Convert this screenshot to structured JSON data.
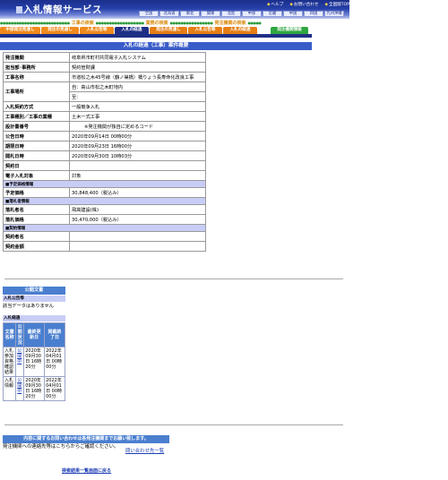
{
  "header": {
    "title": "入札情報サービス",
    "top_links": [
      "ヘルプ",
      "お問い合わせ",
      "全国版TOP"
    ],
    "regions": [
      "全国",
      "北海道",
      "東北",
      "関東",
      "北陸",
      "中部",
      "近畿",
      "中国",
      "四国",
      "九州沖縄"
    ]
  },
  "search_types": [
    "工事の検索",
    "業務の検索",
    "発注機関の検索"
  ],
  "tabs": [
    {
      "label": "中部発注見通し",
      "color": "#f08a1c"
    },
    {
      "label": "発注の見通し",
      "color": "#f08a1c"
    },
    {
      "label": "入札公告等",
      "color": "#f08a1c"
    },
    {
      "label": "入札の経過",
      "color": "#1f2f86"
    },
    {
      "label": "発注の見通し",
      "color": "#e67e14"
    },
    {
      "label": "入札公告等",
      "color": "#e67e14"
    },
    {
      "label": "入札の経過",
      "color": "#e67e14"
    },
    {
      "label": "発注機関情報",
      "color": "#2fa640"
    }
  ],
  "page_title": "入札の経過（工事）案件概要",
  "detail": {
    "order_org_label": "発注機関",
    "order_org": "岐阜県市町村共同電子入札システム",
    "dept_label": "担当部･事務所",
    "dept": "契約管財課",
    "project_label": "工事名称",
    "project": "市道松之木45号線（鶴ノ巣橋）橋りょう長寿命化改良工事",
    "place_label": "工事場所",
    "place1": "自：高山市松之木町地内",
    "place2": "至：",
    "method_label": "入札契約方式",
    "method": "一般競争入札",
    "category_label": "工事種別／工事の業種",
    "category": "土木一式工事",
    "design_no_label": "設計書番号",
    "design_no": "※発注機関が独自に定めるコード",
    "notice_date_label": "公告日時",
    "notice_date": "2020年09月14日 00時00分",
    "open_label": "期限日時",
    "open": "2020年09月23日 16時00分",
    "bid_label": "開札日時",
    "bid": "2020年09月30日 10時03分",
    "contract_date_label": "契約日",
    "contract_date": "",
    "ebid_label": "電子入札対象",
    "ebid": "対象",
    "sec_price": "■予定価格情報",
    "price_label": "予定価格",
    "price": "30,848,400（税込み）",
    "sec_winner": "■落札者情報",
    "winner_label": "落札者名",
    "winner": "飛高建設(株)",
    "win_price_label": "落札価格",
    "win_price": "30,470,000（税込み）",
    "sec_contract": "■契約情報",
    "contractor_label": "契約者名",
    "contractor": "",
    "contract_amount_label": "契約金額",
    "contract_amount": ""
  },
  "documents": {
    "header": "公開文書",
    "notice_head": "入札公告等",
    "notice_none": "該当データはありません",
    "schedule_head": "入札経過",
    "cols": [
      "文書名称",
      "公開状況",
      "最終更新日",
      "掲載終了日"
    ],
    "rows": [
      {
        "name": "入札参加資格確認結果",
        "status": "公開中",
        "updated": "2020年09月30日 16時20分",
        "end": "2022年04月01日 00時00分"
      },
      {
        "name": "入札情報",
        "status": "公開中",
        "updated": "2020年09月30日 16時20分",
        "end": "2022年04月01日 00時00分"
      }
    ]
  },
  "contact": {
    "bar": "内容に関するお問い合わせは各発注機関までお願い致します。",
    "text": "発注機関への連絡先等はこちらからご確認ください。",
    "link": "問い合わせ先一覧"
  },
  "back_link": "検索結果一覧画面に戻る"
}
